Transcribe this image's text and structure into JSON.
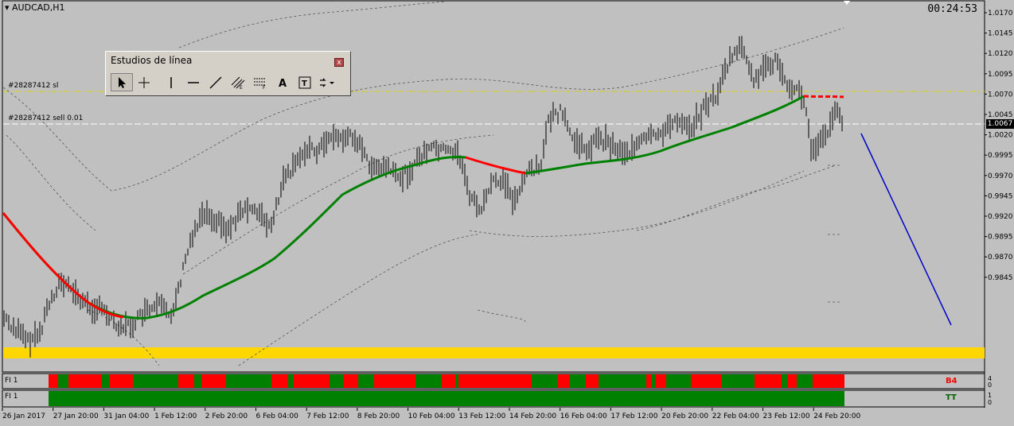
{
  "chart": {
    "title": "AUDCAD,H1",
    "timer": "00:24:53",
    "sl_line_label": "#28287412 sl",
    "order_line_label": "#28287412 sell 0.01",
    "current_price": "1.0067",
    "price_ticks": [
      "1.0170",
      "1.0145",
      "1.0120",
      "1.0095",
      "1.0070",
      "1.0045",
      "1.0020",
      "0.9995",
      "0.9970",
      "0.9945",
      "0.9920",
      "0.9895",
      "0.9870",
      "0.9845"
    ],
    "date_ticks": [
      "26 Jan 2017",
      "27 Jan 20:00",
      "31 Jan 04:00",
      "1 Feb 12:00",
      "2 Feb 20:00",
      "6 Feb 04:00",
      "7 Feb 12:00",
      "8 Feb 20:00",
      "10 Feb 04:00",
      "13 Feb 12:00",
      "14 Feb 20:00",
      "16 Feb 04:00",
      "17 Feb 12:00",
      "20 Feb 20:00",
      "22 Feb 04:00",
      "23 Feb 12:00",
      "24 Feb 20:00"
    ],
    "colors": {
      "background": "#c0c0c0",
      "up_ma": "#008000",
      "down_ma": "#ff0000",
      "support_zone": "#ffd700",
      "trend_line": "#0000c8",
      "sl_line": "#d4d400"
    }
  },
  "indicators": [
    {
      "label": "FI 1",
      "scale_top": "4",
      "scale_bottom": "0",
      "status": "B4"
    },
    {
      "label": "FI 1",
      "scale_top": "1",
      "scale_bottom": "0",
      "status": "TT"
    }
  ],
  "toolwindow": {
    "title": "Estudios de línea",
    "close": "x",
    "tools": [
      {
        "name": "cursor-tool-icon"
      },
      {
        "name": "crosshair-tool-icon"
      },
      {
        "name": "vertical-line-tool-icon"
      },
      {
        "name": "horizontal-line-tool-icon"
      },
      {
        "name": "trendline-tool-icon"
      },
      {
        "name": "equidistant-channel-tool-icon"
      },
      {
        "name": "fibonacci-tool-icon"
      },
      {
        "name": "text-tool-icon",
        "glyph": "A"
      },
      {
        "name": "text-label-tool-icon",
        "glyph": "T"
      },
      {
        "name": "arrows-dropdown-tool-icon"
      }
    ]
  }
}
